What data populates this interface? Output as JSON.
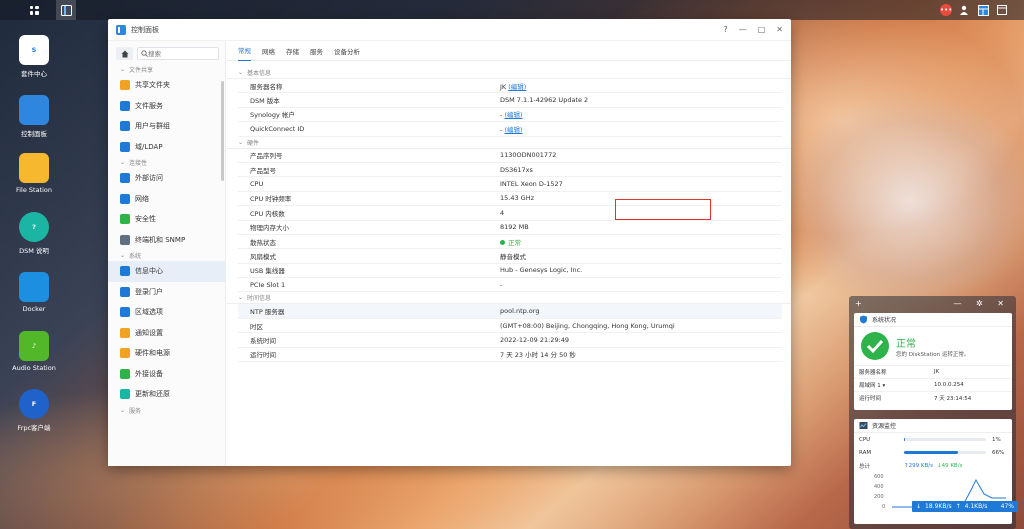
{
  "desktop": {
    "icons": [
      {
        "label": "套件中心",
        "icon": "package-center-icon",
        "color": "#ffffff"
      },
      {
        "label": "控制面板",
        "icon": "control-panel-icon",
        "color": "#2e86de"
      },
      {
        "label": "File Station",
        "icon": "folder-icon",
        "color": "#f5b82e"
      },
      {
        "label": "DSM 说明",
        "icon": "help-icon",
        "color": "#1bb5a3"
      },
      {
        "label": "Docker",
        "icon": "docker-icon",
        "color": "#1d8fe0"
      },
      {
        "label": "Audio Station",
        "icon": "music-icon",
        "color": "#52b829"
      },
      {
        "label": "Frpc客户端",
        "icon": "frpc-icon",
        "color": "#1f62c9"
      }
    ]
  },
  "window": {
    "title": "控制面板",
    "controls": [
      "?",
      "—",
      "□",
      "✕"
    ]
  },
  "sidebar": {
    "search_placeholder": "搜索",
    "sections": [
      {
        "label": "文件共享",
        "items": [
          {
            "label": "共享文件夹"
          },
          {
            "label": "文件服务"
          },
          {
            "label": "用户与群组"
          },
          {
            "label": "域/LDAP"
          }
        ]
      },
      {
        "label": "连接性",
        "items": [
          {
            "label": "外部访问"
          },
          {
            "label": "网络"
          },
          {
            "label": "安全性"
          },
          {
            "label": "终端机和 SNMP"
          }
        ]
      },
      {
        "label": "系统",
        "items": [
          {
            "label": "信息中心"
          },
          {
            "label": "登录门户"
          },
          {
            "label": "区域选项"
          },
          {
            "label": "通知设置"
          },
          {
            "label": "硬件和电源"
          },
          {
            "label": "外接设备"
          },
          {
            "label": "更新和还原"
          }
        ]
      },
      {
        "label": "服务",
        "items": []
      }
    ]
  },
  "tabs": [
    "常规",
    "网络",
    "存储",
    "服务",
    "设备分析"
  ],
  "info": {
    "basic": {
      "label": "基本信息",
      "server_name_k": "服务器名称",
      "server_name_v": "JK",
      "edit": "(编辑)",
      "dsm_k": "DSM 版本",
      "dsm_v": "DSM 7.1.1-42962 Update 2",
      "syn_k": "Synology 帐户",
      "dash": "-",
      "qc_k": "QuickConnect ID"
    },
    "hw": {
      "label": "硬件",
      "serial_k": "产品序列号",
      "serial_v": "1130ODN001772",
      "model_k": "产品型号",
      "model_v": "DS3617xs",
      "cpu_k": "CPU",
      "cpu_v": "INTEL Xeon D-1527",
      "clock_k": "CPU 时钟频率",
      "clock_v": "15.43 GHz",
      "cores_k": "CPU 内核数",
      "cores_v": "4",
      "mem_k": "物理内存大小",
      "mem_v": "8192 MB",
      "thermal_k": "散热状态",
      "thermal_v": "正常",
      "fan_k": "风扇模式",
      "fan_v": "静音模式",
      "usb_k": "USB 集线器",
      "usb_v": "Hub - Genesys Logic, Inc.",
      "pcie_k": "PCIe Slot 1",
      "pcie_v": "-"
    },
    "time": {
      "label": "时间信息",
      "ntp_k": "NTP 服务器",
      "ntp_v": "pool.ntp.org",
      "tz_k": "时区",
      "tz_v": "(GMT+08:00) Beijing, Chongqing, Hong Kong, Urumqi",
      "sys_k": "系统时间",
      "sys_v": "2022-12-09 21:29:49",
      "up_k": "运行时间",
      "up_v": "7 天 23 小时 14 分 50 秒"
    }
  },
  "health": {
    "title": "系统状况",
    "status": "正常",
    "desc": "您的 DiskStation 运转正常。",
    "name_k": "服务器名称",
    "name_v": "JK",
    "lan_k": "局域网 1",
    "lan_v": "10.0.0.254",
    "up_k": "运行时间",
    "up_v": "7 天 23:14:54"
  },
  "resource": {
    "title": "资源监控",
    "cpu_k": "CPU",
    "cpu_v": "1%",
    "cpu_pct": 1,
    "ram_k": "RAM",
    "ram_v": "66%",
    "ram_pct": 66,
    "total_k": "总计",
    "up": "299 KB/s",
    "down": "49 KB/s",
    "ticks": [
      "600",
      "400",
      "200",
      "0"
    ]
  },
  "net": {
    "up": "18.9KB/s",
    "down": "4.1KB/s",
    "pct": "47%"
  }
}
